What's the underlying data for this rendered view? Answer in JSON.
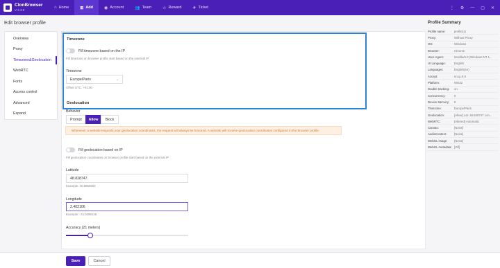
{
  "app": {
    "name": "ClonBrowser",
    "version": "V 2.3.0"
  },
  "nav": [
    {
      "label": "Home",
      "icon": "home-icon",
      "glyph": "⌂"
    },
    {
      "label": "Add",
      "icon": "add-icon",
      "glyph": "⊞"
    },
    {
      "label": "Account",
      "icon": "account-icon",
      "glyph": "◉"
    },
    {
      "label": "Team",
      "icon": "team-icon",
      "glyph": "👥"
    },
    {
      "label": "Reward",
      "icon": "reward-icon",
      "glyph": "☆"
    },
    {
      "label": "Ticket",
      "icon": "ticket-icon",
      "glyph": "✈"
    }
  ],
  "window_controls": [
    "⋮",
    "⚙",
    "—",
    "▢",
    "✕"
  ],
  "page_title": "Edit browser profile",
  "side_menu": [
    "Overview",
    "Proxy",
    "Timezone&Geolocation",
    "WebRTC",
    "Fonts",
    "Access control",
    "Advanced",
    "Expand"
  ],
  "timezone": {
    "title": "Timezone",
    "fill_label": "Fill timezone based on the IP",
    "fill_hint": "Fill timezone on browser profile start based on the external IP",
    "field_label": "Timezone",
    "value": "Europe/Paris",
    "offset": "Offset UTC: +01:00"
  },
  "geolocation": {
    "title": "Geolocation",
    "behavior_label": "Behavior",
    "options": [
      "Prompt",
      "Allow",
      "Block"
    ],
    "selected": "Allow",
    "alert": "Whenever a website requests your geolocation coordinates, the request will always be honored. A website will receive geolocation coordinates configured in the browser profile.",
    "fill_label": "Fill geolocation based on IP",
    "fill_hint": "Fill geolocation coordinates on browser profile start based on the external IP",
    "latitude_label": "Latitude",
    "latitude_value": "48.828747",
    "latitude_example": "Example: 40.8856954",
    "longitude_label": "Longitude",
    "longitude_value": "2.402106",
    "longitude_example": "Example: -74.0299136",
    "accuracy_label": "Accuracy (21 meters)",
    "accuracy_fraction": 0.2
  },
  "summary": {
    "title": "Profile Summary",
    "rows": [
      {
        "k": "Profile name:",
        "v": "profile(1)"
      },
      {
        "k": "Proxy:",
        "v": "Without Proxy"
      },
      {
        "k": "OS:",
        "v": "Windows"
      },
      {
        "k": "Browser:",
        "v": "Chrome"
      },
      {
        "k": "User-Agent:",
        "v": "Mozilla/5.0 (Windows NT 1..."
      },
      {
        "k": "UI Language:",
        "v": "English"
      },
      {
        "k": "Languages:",
        "v": "English(en)"
      },
      {
        "k": "Accept:",
        "v": "en;q=0.9"
      },
      {
        "k": "Platform:",
        "v": "Win32"
      },
      {
        "k": "Double tracking:",
        "v": "on"
      },
      {
        "k": "Concurrency:",
        "v": "8"
      },
      {
        "k": "Device Memory:",
        "v": "8"
      },
      {
        "k": "Timezone:",
        "v": "Europe/Paris"
      },
      {
        "k": "Geolocation:",
        "v": "[Allow] Lat: 48.828747 Lon..."
      },
      {
        "k": "WebRTC:",
        "v": "[Altered] Automatic"
      },
      {
        "k": "Canvas:",
        "v": "[Noise]"
      },
      {
        "k": "AudioContext:",
        "v": "[Noise]"
      },
      {
        "k": "WebGL image:",
        "v": "[Noise]"
      },
      {
        "k": "WebGL metadata:",
        "v": "[Off]"
      }
    ]
  },
  "footer": {
    "save": "Save",
    "cancel": "Cancel"
  },
  "colors": {
    "brand": "#4a1fb8",
    "highlight": "#2b82d9",
    "alert_text": "#d07a2f"
  }
}
